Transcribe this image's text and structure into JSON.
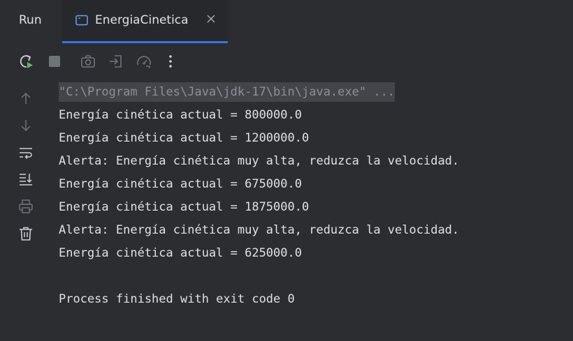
{
  "tabbar": {
    "run_label": "Run",
    "active_tab": {
      "title": "EnergiaCinetica",
      "icon": "console-window-icon"
    }
  },
  "toolbar": {
    "buttons": [
      {
        "name": "rerun-button",
        "icon": "rerun-icon"
      },
      {
        "name": "stop-button",
        "icon": "stop-icon"
      },
      {
        "name": "screenshot-button",
        "icon": "camera-icon"
      },
      {
        "name": "restore-layout-button",
        "icon": "login-icon"
      },
      {
        "name": "profiler-button",
        "icon": "gauge-icon"
      },
      {
        "name": "more-options-button",
        "icon": "more-vertical-icon"
      }
    ]
  },
  "sidebar": {
    "buttons": [
      {
        "name": "scroll-up-button",
        "icon": "arrow-up-icon"
      },
      {
        "name": "scroll-down-button",
        "icon": "arrow-down-icon"
      },
      {
        "name": "soft-wrap-button",
        "icon": "soft-wrap-icon"
      },
      {
        "name": "scroll-to-end-button",
        "icon": "scroll-to-end-icon"
      },
      {
        "name": "print-button",
        "icon": "printer-icon"
      },
      {
        "name": "clear-all-button",
        "icon": "trash-icon"
      }
    ]
  },
  "console": {
    "command": "\"C:\\Program Files\\Java\\jdk-17\\bin\\java.exe\" ...",
    "lines": [
      "Energía cinética actual = 800000.0",
      "Energía cinética actual = 1200000.0",
      "Alerta: Energía cinética muy alta, reduzca la velocidad.",
      "Energía cinética actual = 675000.0",
      "Energía cinética actual = 1875000.0",
      "Alerta: Energía cinética muy alta, reduzca la velocidad.",
      "Energía cinética actual = 625000.0",
      "",
      "Process finished with exit code 0"
    ]
  },
  "colors": {
    "background": "#2b2d30",
    "tab_active_bg": "#26282b",
    "accent": "#3574f0",
    "text": "#dfe1e5",
    "icon_muted": "#6f737a",
    "icon_normal": "#ced0d6",
    "run_green": "#5fb865"
  }
}
